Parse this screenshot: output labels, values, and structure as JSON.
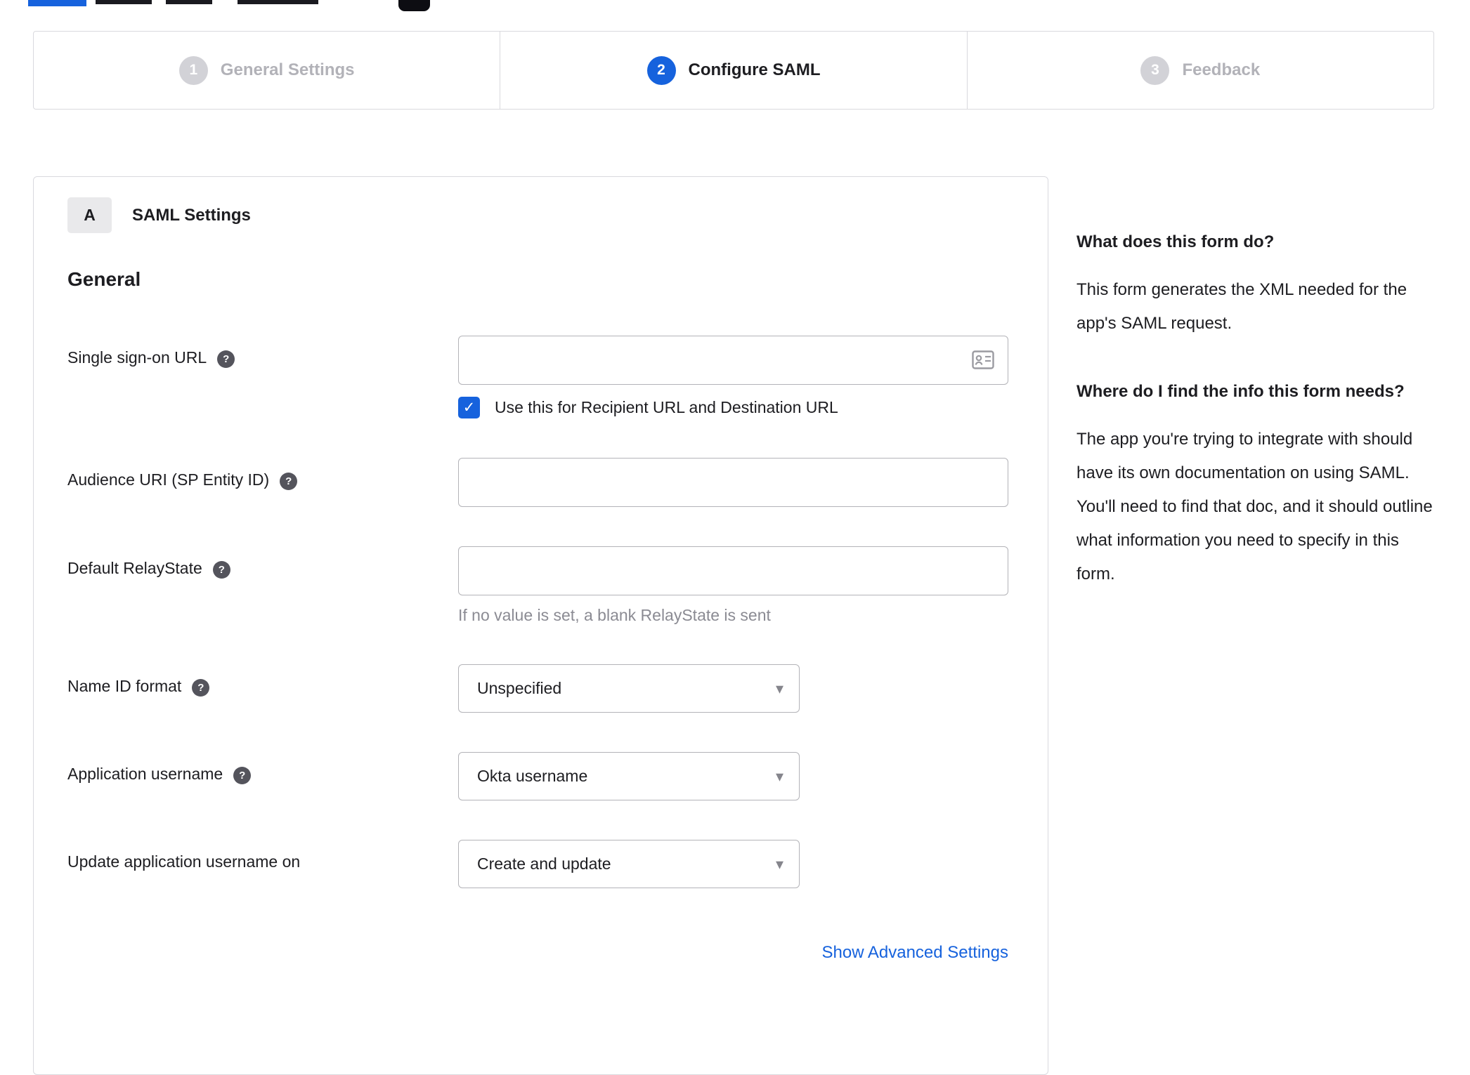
{
  "icons": {
    "check": "✓",
    "caret_down": "▾",
    "help": "?"
  },
  "colors": {
    "accent": "#1662dd",
    "link": "#1662dd",
    "inactive_gray": "#b2b2b8"
  },
  "stepper": {
    "steps": [
      {
        "number": "1",
        "label": "General Settings",
        "active": false
      },
      {
        "number": "2",
        "label": "Configure SAML",
        "active": true
      },
      {
        "number": "3",
        "label": "Feedback",
        "active": false
      }
    ]
  },
  "panel": {
    "section_badge": "A",
    "section_title": "SAML Settings",
    "group_heading": "General",
    "fields": {
      "single_sign_on_url": {
        "label": "Single sign-on URL",
        "value": "",
        "checkbox_label": "Use this for Recipient URL and Destination URL",
        "checkbox_checked": true
      },
      "audience_uri": {
        "label": "Audience URI (SP Entity ID)",
        "value": ""
      },
      "default_relaystate": {
        "label": "Default RelayState",
        "value": "",
        "hint": "If no value is set, a blank RelayState is sent"
      },
      "name_id_format": {
        "label": "Name ID format",
        "value": "Unspecified"
      },
      "application_username": {
        "label": "Application username",
        "value": "Okta username"
      },
      "update_application_username_on": {
        "label": "Update application username on",
        "value": "Create and update"
      }
    },
    "advanced_settings_link": "Show Advanced Settings"
  },
  "sidebar": {
    "sections": [
      {
        "heading": "What does this form do?",
        "body": "This form generates the XML needed for the app's SAML request."
      },
      {
        "heading": "Where do I find the info this form needs?",
        "body": "The app you're trying to integrate with should have its own documentation on using SAML. You'll need to find that doc, and it should outline what information you need to specify in this form."
      }
    ]
  }
}
